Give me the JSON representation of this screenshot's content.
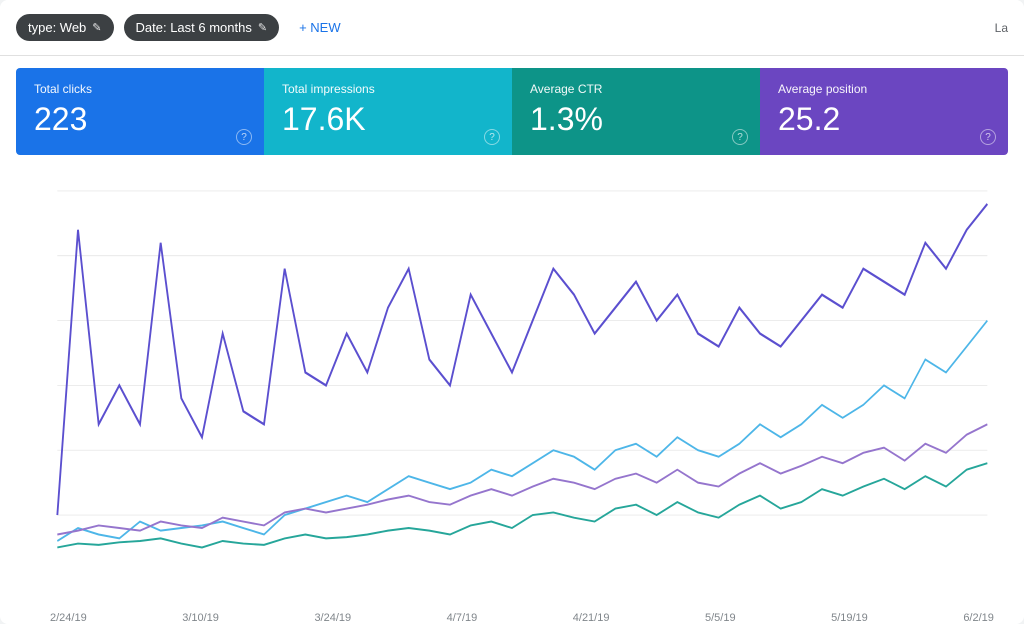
{
  "toolbar": {
    "filter_type_label": "type: Web",
    "filter_date_label": "Date: Last 6 months",
    "new_button_label": "+ NEW",
    "right_label": "La"
  },
  "metrics": {
    "clicks": {
      "label": "Total clicks",
      "value": "223",
      "color": "#1a73e8"
    },
    "impressions": {
      "label": "Total impressions",
      "value": "17.6K",
      "color": "#12b5cb"
    },
    "ctr": {
      "label": "Average CTR",
      "value": "1.3%",
      "color": "#0d9488"
    },
    "position": {
      "label": "Average position",
      "value": "25.2",
      "color": "#6b46c1"
    }
  },
  "chart": {
    "x_labels": [
      "2/24/19",
      "3/10/19",
      "3/24/19",
      "4/7/19",
      "4/21/19",
      "5/5/19",
      "5/19/19",
      "6/2/19"
    ]
  },
  "icons": {
    "edit": "✎",
    "plus": "+",
    "help": "?"
  }
}
